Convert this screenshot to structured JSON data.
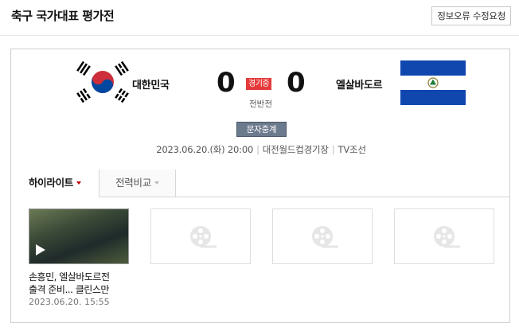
{
  "header": {
    "title": "축구 국가대표 평가전",
    "report_label": "정보오류 수정요청"
  },
  "match": {
    "home": {
      "name": "대한민국",
      "score": "0",
      "flag_icon": "korea-flag-icon"
    },
    "away": {
      "name": "엘살바도르",
      "score": "0",
      "flag_icon": "el-salvador-flag-icon"
    },
    "status": "경기중",
    "period": "전반전",
    "text_relay_label": "문자중계",
    "date_time": "2023.06.20.(화) 20:00",
    "venue": "대전월드컵경기장",
    "broadcaster": "TV조선"
  },
  "tabs": [
    {
      "label": "하이라이트",
      "active": true
    },
    {
      "label": "전력비교",
      "active": false
    }
  ],
  "videos": [
    {
      "title_line1": "손흥민, 엘살바도르전",
      "title_line2": "출격 준비... 클린스만",
      "date": "2023.06.20. 15:55",
      "has_thumbnail": true
    },
    {
      "title_line1": "",
      "title_line2": "",
      "date": "",
      "has_thumbnail": false
    },
    {
      "title_line1": "",
      "title_line2": "",
      "date": "",
      "has_thumbnail": false
    },
    {
      "title_line1": "",
      "title_line2": "",
      "date": "",
      "has_thumbnail": false
    }
  ],
  "colors": {
    "status_badge": "#e63a3a",
    "tab_caret": "#c40000",
    "relay_button": "#6c7a8d"
  }
}
